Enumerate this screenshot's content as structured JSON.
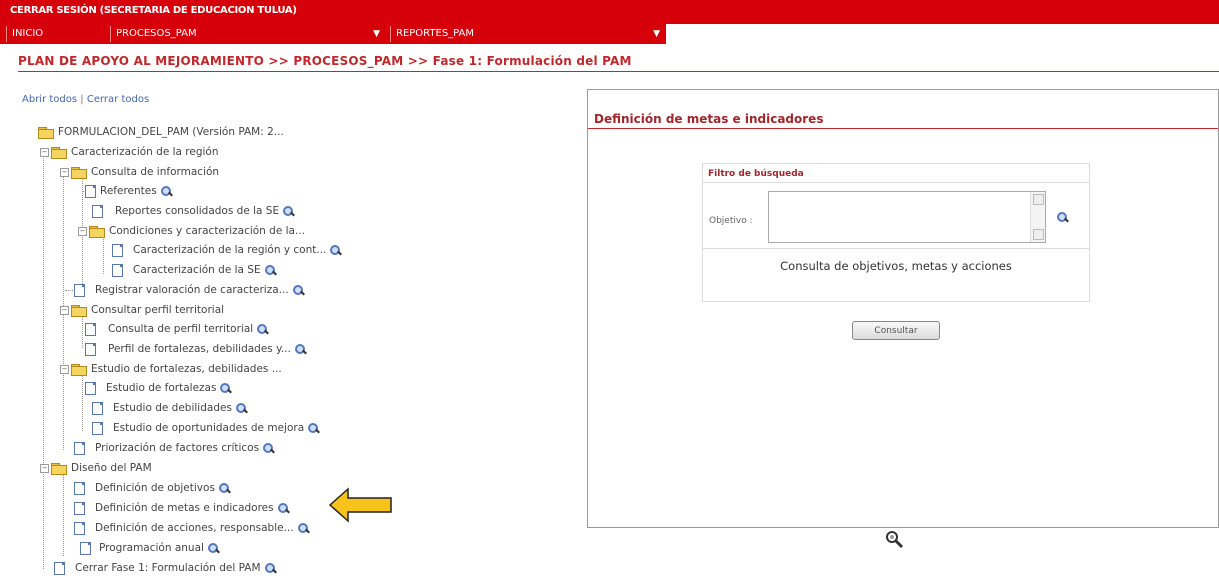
{
  "header": {
    "logout_label": "CERRAR SESIÓN (SECRETARIA DE EDUCACION TULUA)"
  },
  "nav": {
    "items": [
      {
        "label": "INICIO"
      },
      {
        "label": "PROCESOS_PAM"
      },
      {
        "label": "REPORTES_PAM"
      }
    ]
  },
  "breadcrumb": "PLAN DE APOYO AL MEJORAMIENTO >> PROCESOS_PAM >> Fase 1: Formulación del PAM",
  "tree_controls": {
    "open_all": "Abrir todos",
    "separator": "|",
    "close_all": "Cerrar todos"
  },
  "tree": {
    "root": "FORMULACION_DEL_PAM (Versión PAM: 2...",
    "items": [
      "Caracterización de la región",
      "Consulta de información",
      "Referentes",
      "Reportes consolidados de la SE",
      "Condiciones y caracterización de la...",
      "Caracterización de la región y cont...",
      "Caracterización de la SE",
      "Registrar valoración de caracteriza...",
      "Consultar perfil territorial",
      "Consulta de perfil territorial",
      "Perfil de fortalezas, debilidades y...",
      "Estudio de fortalezas, debilidades ...",
      "Estudio de fortalezas",
      "Estudio de debilidades",
      "Estudio de oportunidades de mejora",
      "Priorización de factores críticos",
      "Diseño del PAM",
      "Definición de objetivos",
      "Definición de metas e indicadores",
      "Definición de acciones, responsable...",
      "Programación anual",
      "Cerrar Fase 1: Formulación del PAM"
    ]
  },
  "panel": {
    "title": "Definición de metas e indicadores",
    "filter_title": "Filtro de búsqueda",
    "objective_label": "Objetivo :",
    "objective_value": "",
    "consulta_text": "Consulta de objetivos, metas y acciones",
    "button_label": "Consultar"
  },
  "colors": {
    "brand_red": "#d6000a",
    "title_red": "#a0282d",
    "link_blue": "#4466aa",
    "arrow_yellow": "#f7c21c"
  }
}
